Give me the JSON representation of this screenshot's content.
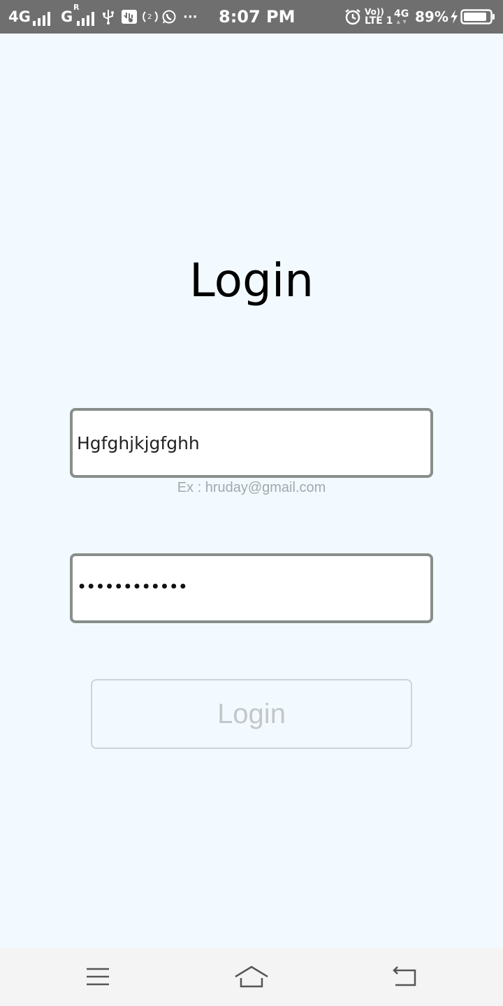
{
  "status_bar": {
    "network_1": "4G",
    "network_2": "G",
    "roaming_mark": "R",
    "more": "···",
    "time": "8:07 PM",
    "volte_top": "Vo))",
    "volte_bottom": "LTE 1",
    "network_3": "4G",
    "battery_percent": "89%",
    "battery_level": 0.89
  },
  "login": {
    "title": "Login",
    "email_value": "Hgfghjkjgfghh",
    "email_hint": "Ex : hruday@gmail.com",
    "password_value": "••••••••••••",
    "button_label": "Login"
  },
  "nav": {
    "icons": [
      "menu-icon",
      "home-icon",
      "back-icon"
    ]
  }
}
